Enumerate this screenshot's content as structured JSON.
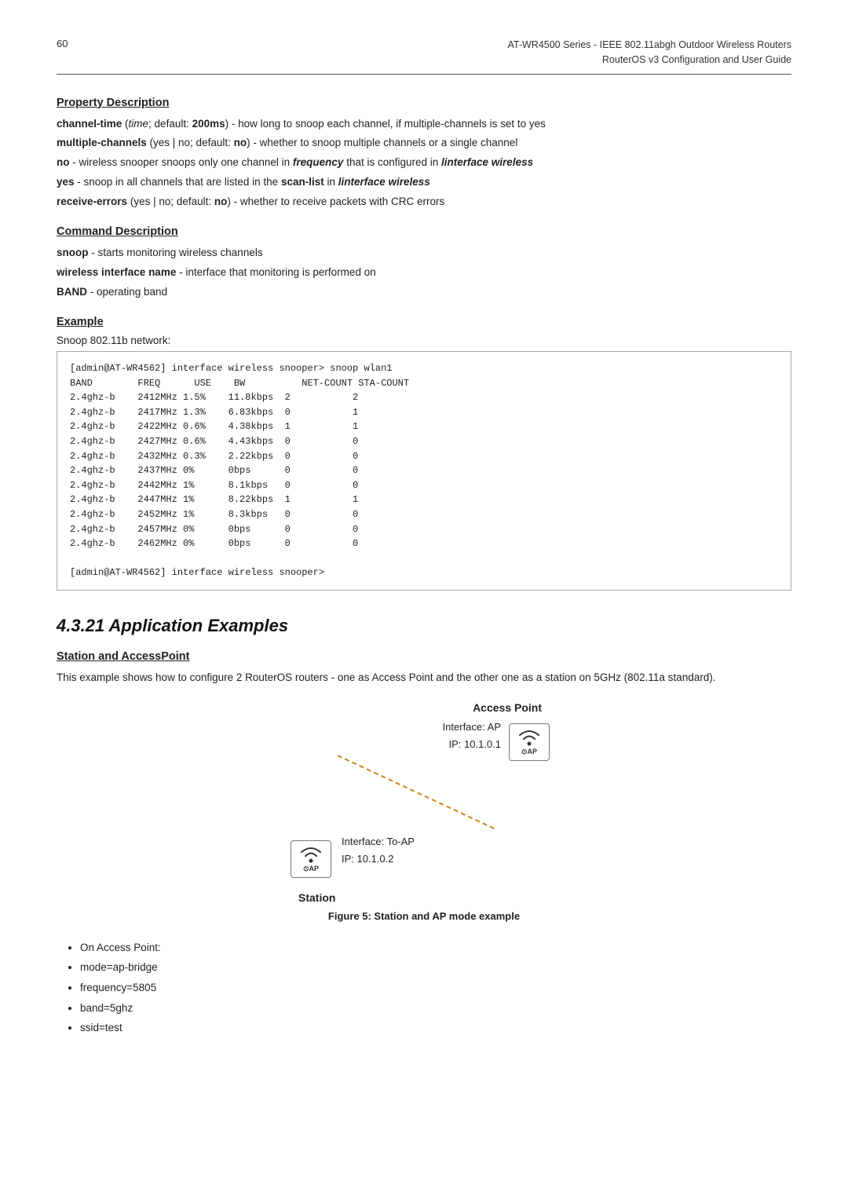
{
  "header": {
    "page_number": "60",
    "title_line1": "AT-WR4500 Series - IEEE 802.11abgh Outdoor Wireless Routers",
    "title_line2": "RouterOS v3 Configuration and User Guide"
  },
  "property_description": {
    "heading": "Property Description",
    "items": [
      {
        "term": "channel-time",
        "extra": " (time; default: 200ms)",
        "desc": " - how long to snoop each channel, if multiple-channels is set to yes"
      },
      {
        "term": "multiple-channels",
        "extra": " (yes | no; default: no)",
        "desc": " - whether to snoop multiple channels or a single channel"
      },
      {
        "term": "no",
        "desc": " - wireless snooper snoops only one channel in ",
        "italic1": "frequency",
        "desc2": " that is configured in ",
        "italic2": "linterface wireless"
      },
      {
        "term": "yes",
        "desc": " - snoop in all channels that are listed in the ",
        "bold1": "scan-list",
        "desc2": " in ",
        "italic1": "linterface wireless"
      },
      {
        "term": "receive-errors",
        "extra": " (yes | no; default: no)",
        "desc": " - whether to receive packets with CRC errors"
      }
    ]
  },
  "command_description": {
    "heading": "Command Description",
    "items": [
      {
        "term": "snoop",
        "desc": " - starts monitoring wireless channels"
      },
      {
        "term": "wireless interface name",
        "desc": " - interface that monitoring is performed on"
      },
      {
        "term": "BAND",
        "desc": " - operating band"
      }
    ]
  },
  "example": {
    "heading": "Example",
    "label": "Snoop 802.11b network:",
    "code": "[admin@AT-WR4562] interface wireless snooper> snoop wlan1\nBAND        FREQ      USE    BW          NET-COUNT STA-COUNT\n2.4ghz-b    2412MHz 1.5%    11.8kbps  2           2\n2.4ghz-b    2417MHz 1.3%    6.83kbps  0           1\n2.4ghz-b    2422MHz 0.6%    4.38kbps  1           1\n2.4ghz-b    2427MHz 0.6%    4.43kbps  0           0\n2.4ghz-b    2432MHz 0.3%    2.22kbps  0           0\n2.4ghz-b    2437MHz 0%      0bps      0           0\n2.4ghz-b    2442MHz 1%      8.1kbps   0           0\n2.4ghz-b    2447MHz 1%      8.22kbps  1           1\n2.4ghz-b    2452MHz 1%      8.3kbps   0           0\n2.4ghz-b    2457MHz 0%      0bps      0           0\n2.4ghz-b    2462MHz 0%      0bps      0           0\n\n[admin@AT-WR4562] interface wireless snooper>"
  },
  "section_title": "4.3.21   Application Examples",
  "station_ap": {
    "heading": "Station and AccessPoint",
    "desc": "This example shows how to configure 2 RouterOS routers - one as Access Point and the other one as a station on 5GHz (802.11a standard).",
    "ap_label": "Access Point",
    "ap_interface": "Interface: AP",
    "ap_ip": "IP: 10.1.0.1",
    "station_interface": "Interface: To-AP",
    "station_ip": "IP: 10.1.0.2",
    "station_label": "Station",
    "figure_caption": "Figure 5: Station and AP mode example"
  },
  "bullet_list": {
    "intro": "On Access Point:",
    "items": [
      "On Access Point:",
      "mode=ap-bridge",
      "frequency=5805",
      "band=5ghz",
      "ssid=test"
    ]
  }
}
